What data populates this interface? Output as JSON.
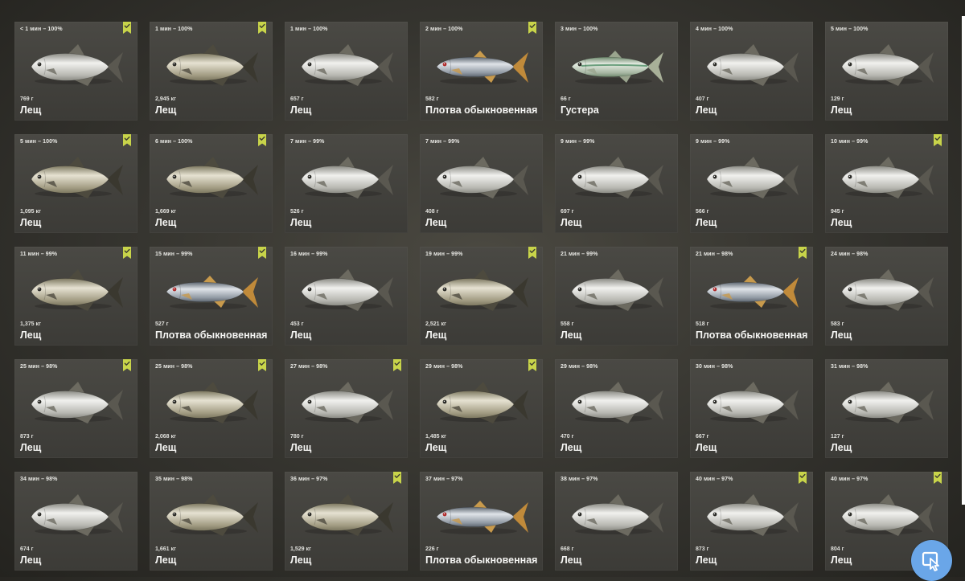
{
  "cards": [
    {
      "time": "< 1 мин – 100%",
      "weight": "769 г",
      "name": "Лещ",
      "fish": "bream-silver",
      "bookmarked": true
    },
    {
      "time": "1 мин – 100%",
      "weight": "2,945 кг",
      "name": "Лещ",
      "fish": "bream-bronze",
      "bookmarked": true
    },
    {
      "time": "1 мин – 100%",
      "weight": "657 г",
      "name": "Лещ",
      "fish": "bream-silver",
      "bookmarked": false
    },
    {
      "time": "2 мин – 100%",
      "weight": "582 г",
      "name": "Плотва обыкновенная",
      "fish": "roach",
      "bookmarked": true
    },
    {
      "time": "3 мин – 100%",
      "weight": "66 г",
      "name": "Густера",
      "fish": "bleak",
      "bookmarked": false
    },
    {
      "time": "4 мин – 100%",
      "weight": "407 г",
      "name": "Лещ",
      "fish": "bream-silver",
      "bookmarked": false
    },
    {
      "time": "5 мин – 100%",
      "weight": "129 г",
      "name": "Лещ",
      "fish": "bream-silver",
      "bookmarked": false
    },
    {
      "time": "5 мин – 100%",
      "weight": "1,095 кг",
      "name": "Лещ",
      "fish": "bream-bronze",
      "bookmarked": true
    },
    {
      "time": "6 мин – 100%",
      "weight": "1,669 кг",
      "name": "Лещ",
      "fish": "bream-bronze",
      "bookmarked": true
    },
    {
      "time": "7 мин – 99%",
      "weight": "526 г",
      "name": "Лещ",
      "fish": "bream-silver",
      "bookmarked": false
    },
    {
      "time": "7 мин – 99%",
      "weight": "408 г",
      "name": "Лещ",
      "fish": "bream-silver",
      "bookmarked": false
    },
    {
      "time": "9 мин – 99%",
      "weight": "697 г",
      "name": "Лещ",
      "fish": "bream-silver",
      "bookmarked": false
    },
    {
      "time": "9 мин – 99%",
      "weight": "566 г",
      "name": "Лещ",
      "fish": "bream-silver",
      "bookmarked": false
    },
    {
      "time": "10 мин – 99%",
      "weight": "945 г",
      "name": "Лещ",
      "fish": "bream-silver",
      "bookmarked": true
    },
    {
      "time": "11 мин – 99%",
      "weight": "1,375 кг",
      "name": "Лещ",
      "fish": "bream-bronze",
      "bookmarked": true
    },
    {
      "time": "15 мин – 99%",
      "weight": "527 г",
      "name": "Плотва обыкновенная",
      "fish": "roach",
      "bookmarked": true
    },
    {
      "time": "16 мин – 99%",
      "weight": "453 г",
      "name": "Лещ",
      "fish": "bream-silver",
      "bookmarked": false
    },
    {
      "time": "19 мин – 99%",
      "weight": "2,521 кг",
      "name": "Лещ",
      "fish": "bream-bronze",
      "bookmarked": true
    },
    {
      "time": "21 мин – 99%",
      "weight": "558 г",
      "name": "Лещ",
      "fish": "bream-silver",
      "bookmarked": false
    },
    {
      "time": "21 мин – 98%",
      "weight": "518 г",
      "name": "Плотва обыкновенная",
      "fish": "roach",
      "bookmarked": true
    },
    {
      "time": "24 мин – 98%",
      "weight": "583 г",
      "name": "Лещ",
      "fish": "bream-silver",
      "bookmarked": false
    },
    {
      "time": "25 мин – 98%",
      "weight": "873 г",
      "name": "Лещ",
      "fish": "bream-silver",
      "bookmarked": true
    },
    {
      "time": "25 мин – 98%",
      "weight": "2,068 кг",
      "name": "Лещ",
      "fish": "bream-bronze",
      "bookmarked": true
    },
    {
      "time": "27 мин – 98%",
      "weight": "780 г",
      "name": "Лещ",
      "fish": "bream-silver",
      "bookmarked": true
    },
    {
      "time": "29 мин – 98%",
      "weight": "1,485 кг",
      "name": "Лещ",
      "fish": "bream-bronze",
      "bookmarked": true
    },
    {
      "time": "29 мин – 98%",
      "weight": "470 г",
      "name": "Лещ",
      "fish": "bream-silver",
      "bookmarked": false
    },
    {
      "time": "30 мин – 98%",
      "weight": "667 г",
      "name": "Лещ",
      "fish": "bream-silver",
      "bookmarked": false
    },
    {
      "time": "31 мин – 98%",
      "weight": "127 г",
      "name": "Лещ",
      "fish": "bream-silver",
      "bookmarked": false
    },
    {
      "time": "34 мин – 98%",
      "weight": "674 г",
      "name": "Лещ",
      "fish": "bream-silver",
      "bookmarked": false
    },
    {
      "time": "35 мин – 98%",
      "weight": "1,661 кг",
      "name": "Лещ",
      "fish": "bream-bronze",
      "bookmarked": false
    },
    {
      "time": "36 мин – 97%",
      "weight": "1,529 кг",
      "name": "Лещ",
      "fish": "bream-bronze",
      "bookmarked": true
    },
    {
      "time": "37 мин – 97%",
      "weight": "226 г",
      "name": "Плотва обыкновенная",
      "fish": "roach",
      "bookmarked": false
    },
    {
      "time": "38 мин – 97%",
      "weight": "668 г",
      "name": "Лещ",
      "fish": "bream-silver",
      "bookmarked": false
    },
    {
      "time": "40 мин – 97%",
      "weight": "873 г",
      "name": "Лещ",
      "fish": "bream-silver",
      "bookmarked": true
    },
    {
      "time": "40 мин – 97%",
      "weight": "804 г",
      "name": "Лещ",
      "fish": "bream-silver",
      "bookmarked": true
    }
  ],
  "colors": {
    "bookmark": "#c8d44a",
    "bookmark_check": "#3a3a30",
    "cursor_button": "#6aa6e8"
  },
  "overlay": {
    "icon": "cursor-select-icon"
  }
}
